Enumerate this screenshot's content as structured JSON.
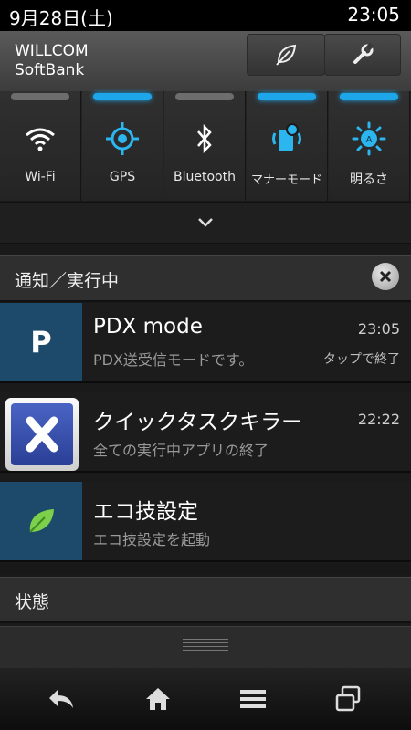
{
  "status_bar": {
    "date": "9月28日(土)",
    "time": "23:05"
  },
  "carrier": {
    "line1": "WILLCOM",
    "line2": "SoftBank"
  },
  "quick_toggles": [
    {
      "label": "Wi-Fi",
      "icon": "wifi-icon",
      "on": false
    },
    {
      "label": "GPS",
      "icon": "gps-icon",
      "on": true
    },
    {
      "label": "Bluetooth",
      "icon": "bluetooth-icon",
      "on": false
    },
    {
      "label": "マナーモード",
      "icon": "manner-mode-icon",
      "on": true
    },
    {
      "label": "明るさ",
      "icon": "brightness-icon",
      "on": true
    }
  ],
  "sections": {
    "notifications": "通知／実行中",
    "status": "状態"
  },
  "notifications": [
    {
      "title": "PDX mode",
      "text": "PDX送受信モードです。",
      "time": "23:05",
      "action": "タップで終了",
      "icon_text": "P"
    },
    {
      "title": "クイックタスクキラー",
      "text": "全ての実行中アプリの終了",
      "time": "22:22"
    },
    {
      "title": "エコ技設定",
      "text": "エコ技設定を起動"
    }
  ],
  "colors": {
    "accent": "#1ea6ea",
    "notif_icon_bg": "#1d4a6b"
  }
}
